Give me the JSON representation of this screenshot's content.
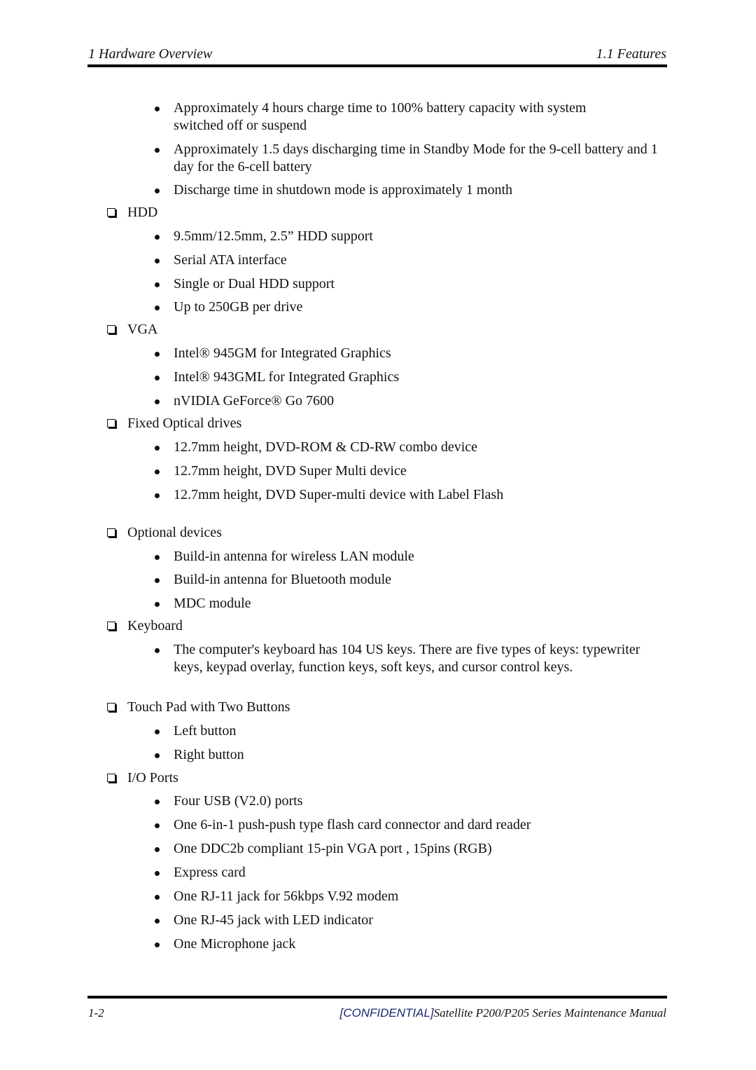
{
  "header": {
    "left": "1  Hardware Overview",
    "right": "1.1  Features"
  },
  "footer": {
    "page": "1-2",
    "confidential": "[CONFIDENTIAL]",
    "manual": "Satellite P200/P205 Series Maintenance Manual"
  },
  "intro_bullets": [
    "Approximately 4 hours charge time to 100% battery capacity with system switched off or suspend",
    "Approximately 1.5 days discharging time in Standby Mode for the 9-cell battery and 1 day for the 6-cell battery",
    "Discharge time in shutdown mode is approximately 1 month"
  ],
  "sections": [
    {
      "title": "HDD",
      "items": [
        "9.5mm/12.5mm, 2.5” HDD support",
        "Serial ATA interface",
        "Single or Dual HDD support",
        "Up to 250GB per drive"
      ]
    },
    {
      "title": "VGA",
      "items": [
        "Intel® 945GM for Integrated Graphics",
        "Intel® 943GML for Integrated Graphics",
        "nVIDIA GeForce® Go 7600"
      ]
    },
    {
      "title": "Fixed Optical drives",
      "items": [
        "12.7mm height, DVD-ROM & CD-RW combo device",
        "12.7mm height, DVD Super Multi device",
        "12.7mm height, DVD Super-multi device with Label Flash"
      ]
    },
    {
      "title": "Optional devices",
      "items": [
        "Build-in antenna for wireless LAN module",
        "Build-in antenna for Bluetooth module",
        "MDC module"
      ]
    },
    {
      "title": "Keyboard",
      "items": [
        "The computer's keyboard has 104 US keys. There are five types of keys: typewriter keys, keypad overlay, function keys, soft keys, and cursor control keys."
      ]
    },
    {
      "title": "Touch Pad with Two Buttons",
      "items": [
        "Left button",
        "Right button"
      ]
    },
    {
      "title": "I/O Ports",
      "items": [
        "Four USB (V2.0) ports",
        "One 6-in-1 push-push type flash card connector and dard reader",
        "One DDC2b compliant 15-pin VGA port , 15pins (RGB)",
        "Express card",
        "One RJ-11 jack for 56kbps V.92 modem",
        "One RJ-45 jack with LED indicator",
        "One Microphone jack"
      ]
    }
  ]
}
